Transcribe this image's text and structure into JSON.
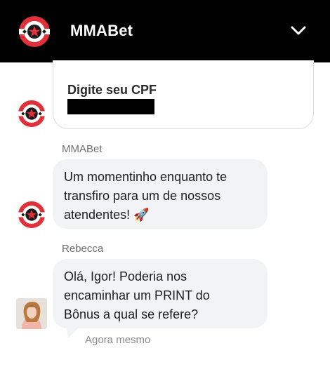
{
  "header": {
    "title": "MMABet",
    "logo_icon": "mmabet-logo-icon",
    "collapse_icon": "chevron-down-icon"
  },
  "form": {
    "label": "Digite seu CPF",
    "value_redacted": true
  },
  "messages": [
    {
      "sender": "MMABet",
      "lines": [
        "Um momentinho enquanto te",
        "transfiro para um de nossos",
        "atendentes! 🚀"
      ]
    },
    {
      "sender": "Rebecca",
      "lines": [
        "Olá, Igor! Poderia nos",
        "encaminhar um PRINT do",
        "Bônus a qual se refere?"
      ]
    }
  ],
  "status": {
    "timestamp": "Agora mesmo"
  },
  "colors": {
    "header_bg": "#000000",
    "logo_red": "#e0303a",
    "bubble_bg": "#f2f3f5"
  }
}
